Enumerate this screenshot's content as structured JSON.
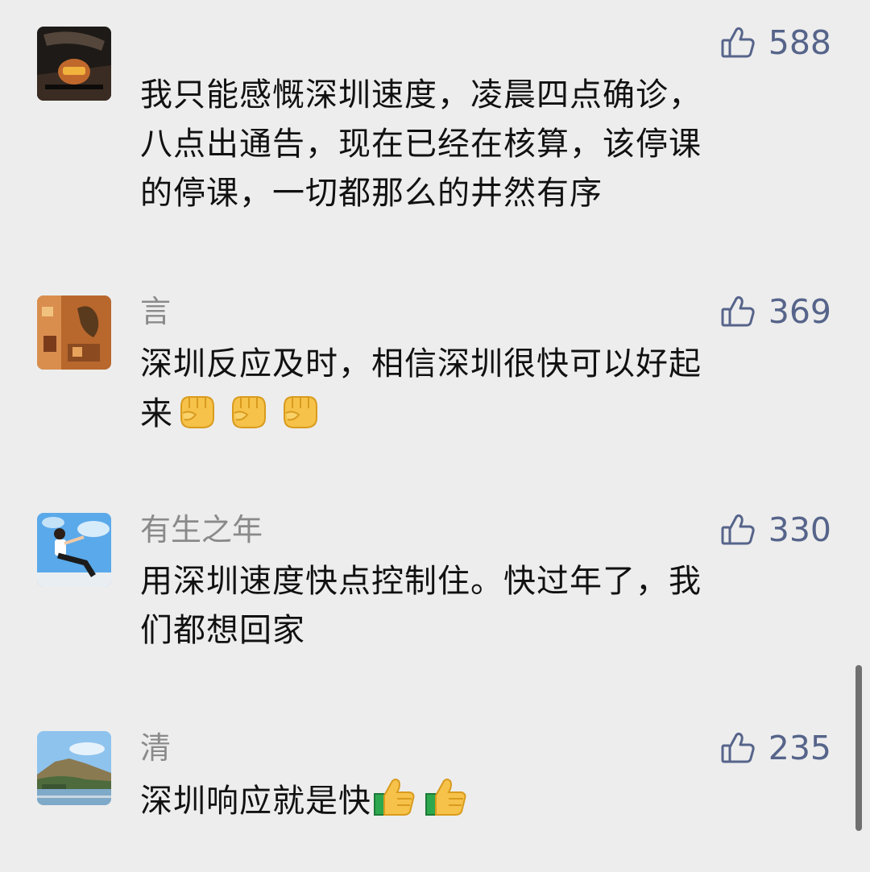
{
  "comments": [
    {
      "name": "",
      "likes": "588",
      "avatar_icon": "avatar-photo-car-interior",
      "lines": [
        "我只能感慨深圳速度，凌晨四点确诊，",
        "八点出通告，现在已经在核算，该停课",
        "的停课，一切都那么的井然有序"
      ]
    },
    {
      "name": "言",
      "likes": "369",
      "avatar_icon": "avatar-photo-warm-room",
      "lines": [
        "深圳反应及时，相信深圳很快可以好起",
        "来"
      ],
      "emoji": [
        "raised-fist",
        "raised-fist",
        "raised-fist"
      ]
    },
    {
      "name": "有生之年",
      "likes": "330",
      "avatar_icon": "avatar-photo-boy-sky",
      "lines": [
        "用深圳速度快点控制住。快过年了，我",
        "们都想回家"
      ]
    },
    {
      "name": "清",
      "likes": "235",
      "avatar_icon": "avatar-photo-mountain-lake",
      "lines": [
        "深圳响应就是快"
      ],
      "emoji": [
        "thumbs-up",
        "thumbs-up"
      ]
    }
  ],
  "colors": {
    "background": "#ededed",
    "likes": "#56648a",
    "name": "#8a8a8a",
    "text": "#111111"
  }
}
